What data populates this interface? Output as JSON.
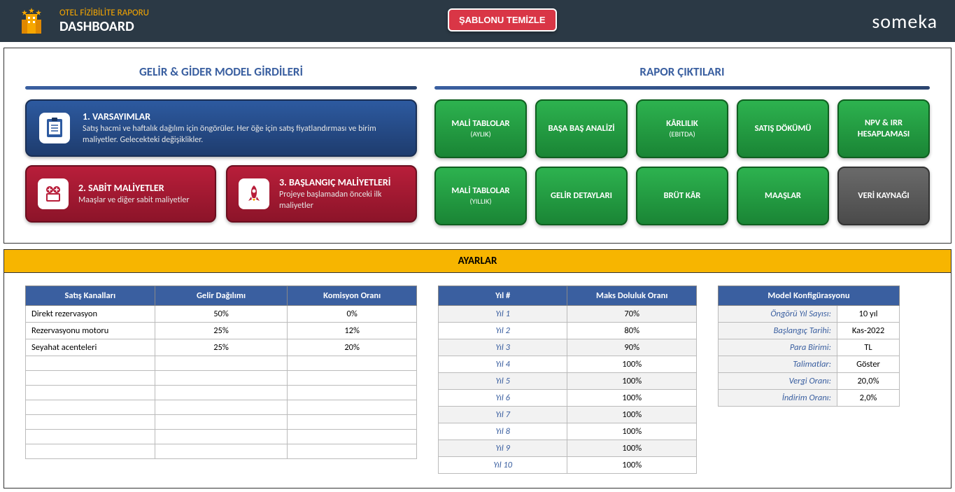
{
  "header": {
    "subtitle": "OTEL FİZİBİLİTE RAPORU",
    "title": "DASHBOARD",
    "clear_button": "ŞABLONU TEMİZLE",
    "brand": "someka"
  },
  "inputs": {
    "section_title": "GELİR & GİDER MODEL GİRDİLERİ",
    "card1": {
      "title": "1. VARSAYIMLAR",
      "desc": "Satış hacmi ve haftalık dağılım için öngörüler. Her öğe için satış  fiyatlandırması ve birim maliyetler. Gelecekteki değişiklikler."
    },
    "card2": {
      "title": "2. SABİT MALİYETLER",
      "desc": "Maaşlar ve diğer sabit maliyetler"
    },
    "card3": {
      "title": "3. BAŞLANGIÇ MALİYETLERİ",
      "desc": "Projeye başlamadan önceki ilk maliyetler"
    }
  },
  "outputs": {
    "section_title": "RAPOR ÇIKTILARI",
    "buttons": [
      {
        "label": "MALİ TABLOLAR",
        "sub": "(AYLIK)"
      },
      {
        "label": "BAŞA BAŞ ANALİZİ",
        "sub": ""
      },
      {
        "label": "KÂRLILIK",
        "sub": "(EBITDA)"
      },
      {
        "label": "SATIŞ DÖKÜMÜ",
        "sub": ""
      },
      {
        "label": "NPV & IRR HESAPLAMASI",
        "sub": ""
      },
      {
        "label": "MALİ TABLOLAR",
        "sub": "(YILLIK)"
      },
      {
        "label": "GELİR DETAYLARI",
        "sub": ""
      },
      {
        "label": "BRÜT KÂR",
        "sub": ""
      },
      {
        "label": "MAAŞLAR",
        "sub": ""
      },
      {
        "label": "VERİ KAYNAĞI",
        "sub": ""
      }
    ]
  },
  "settings": {
    "title": "AYARLAR",
    "channels": {
      "headers": [
        "Satış Kanalları",
        "Gelir Dağılımı",
        "Komisyon Oranı"
      ],
      "rows": [
        {
          "name": "Direkt rezervasyon",
          "dist": "50%",
          "comm": "0%"
        },
        {
          "name": "Rezervasyonu motoru",
          "dist": "25%",
          "comm": "12%"
        },
        {
          "name": "Seyahat acenteleri",
          "dist": "25%",
          "comm": "20%"
        }
      ]
    },
    "occupancy": {
      "headers": [
        "Yıl #",
        "Maks Doluluk Oranı"
      ],
      "rows": [
        {
          "year": "Yıl 1",
          "rate": "70%"
        },
        {
          "year": "Yıl 2",
          "rate": "80%"
        },
        {
          "year": "Yıl 3",
          "rate": "90%"
        },
        {
          "year": "Yıl 4",
          "rate": "100%"
        },
        {
          "year": "Yıl 5",
          "rate": "100%"
        },
        {
          "year": "Yıl 6",
          "rate": "100%"
        },
        {
          "year": "Yıl 7",
          "rate": "100%"
        },
        {
          "year": "Yıl 8",
          "rate": "100%"
        },
        {
          "year": "Yıl 9",
          "rate": "100%"
        },
        {
          "year": "Yıl 10",
          "rate": "100%"
        }
      ]
    },
    "config": {
      "header": "Model Konfigürasyonu",
      "rows": [
        {
          "label": "Öngörü Yıl Sayısı:",
          "value": "10 yıl"
        },
        {
          "label": "Başlangıç Tarihi:",
          "value": "Kas-2022"
        },
        {
          "label": "Para Birimi:",
          "value": "TL"
        },
        {
          "label": "Talimatlar:",
          "value": "Göster"
        },
        {
          "label": "Vergi Oranı:",
          "value": "20,0%"
        },
        {
          "label": "İndirim Oranı:",
          "value": "2,0%"
        }
      ]
    }
  }
}
